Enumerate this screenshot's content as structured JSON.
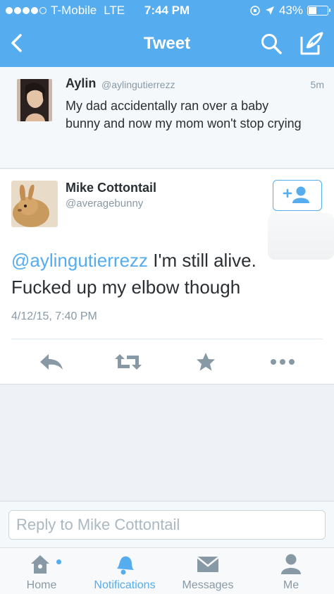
{
  "status_bar": {
    "carrier": "T-Mobile",
    "network": "LTE",
    "time": "7:44 PM",
    "battery": "43%",
    "battery_level": 0.43
  },
  "nav": {
    "title": "Tweet",
    "back_icon": "chevron-left-icon",
    "search_icon": "search-icon",
    "compose_icon": "compose-icon"
  },
  "context_tweet": {
    "name": "Aylin",
    "handle": "@aylingutierrezz",
    "time": "5m",
    "text": "My dad accidentally ran over a baby bunny and now my mom won't stop crying"
  },
  "main_tweet": {
    "name": "Mike Cottontail",
    "handle": "@averagebunny",
    "mention": "@aylingutierrezz",
    "text": " I'm still alive. Fucked up my elbow though",
    "date": "4/12/15, 7:40 PM"
  },
  "reply": {
    "placeholder": "Reply to Mike Cottontail"
  },
  "tabs": [
    {
      "label": "Home",
      "icon": "home-icon",
      "active": false
    },
    {
      "label": "Notifications",
      "icon": "bell-icon",
      "active": true
    },
    {
      "label": "Messages",
      "icon": "envelope-icon",
      "active": false
    },
    {
      "label": "Me",
      "icon": "person-icon",
      "active": false
    }
  ],
  "colors": {
    "brand": "#55acee",
    "text": "#292f33",
    "secondary": "#8899a6"
  }
}
